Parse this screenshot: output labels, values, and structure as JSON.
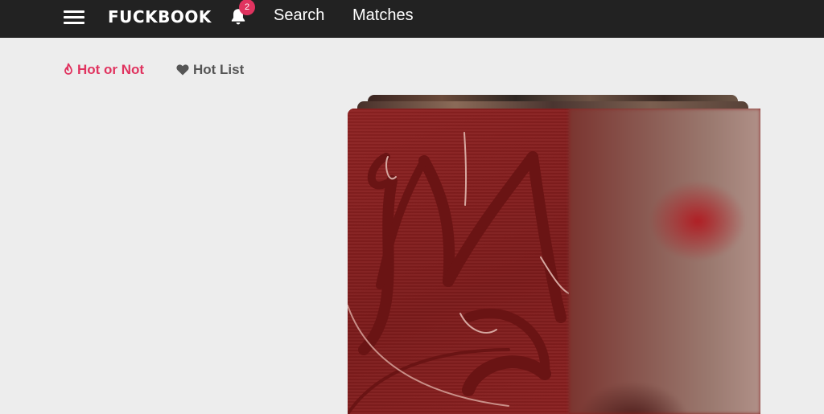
{
  "header": {
    "logo": "FUCKBOOK",
    "notifications_count": "2",
    "nav": {
      "search": "Search",
      "matches": "Matches"
    }
  },
  "tabs": {
    "hot_or_not": "Hot or Not",
    "hot_list": "Hot List"
  },
  "colors": {
    "accent": "#e0335f",
    "topbar": "#222222",
    "background": "#ededed"
  },
  "icons": [
    "menu-icon",
    "bell-icon",
    "flame-icon",
    "heart-icon"
  ]
}
